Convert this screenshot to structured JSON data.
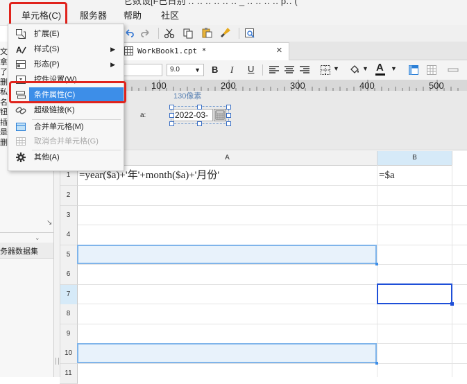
{
  "menubar": {
    "items": [
      "单元格(C)",
      "服务器",
      "帮助",
      "社区"
    ],
    "title_fragment": "它数设[F已日别 ‥  ‥   ‥ ‥  ‥ ‥ _  ‥ ‥ ‥ ‥ p‥ ("
  },
  "tab": {
    "label": "WorkBook1.cpt *",
    "close": "×"
  },
  "format_toolbar": {
    "font_size": "9.0",
    "bold": "B",
    "italic": "I",
    "underline": "U",
    "font_color": "A"
  },
  "ruler": {
    "ticks": [
      "100",
      "200",
      "300",
      "400",
      "500"
    ]
  },
  "param_area": {
    "px_label": "130像素",
    "param_label": "a:",
    "date_value": "2022-03-"
  },
  "left_panel": {
    "truncated_chars": [
      "文",
      "拿",
      "了",
      "删",
      "私",
      "名",
      "钮",
      "插",
      "是",
      "删"
    ],
    "dataset_label": "务器数据集"
  },
  "dropdown": {
    "items": [
      {
        "label": "扩展(E)",
        "icon": "expand-icon",
        "submenu": false,
        "disabled": false
      },
      {
        "label": "样式(S)",
        "icon": "style-icon",
        "submenu": true,
        "disabled": false
      },
      {
        "label": "形态(P)",
        "icon": "form-icon",
        "submenu": true,
        "disabled": false
      },
      {
        "label": "控件设置(W)",
        "icon": "widget-icon",
        "submenu": false,
        "disabled": false
      },
      {
        "label": "条件属性(C)",
        "icon": "condition-icon",
        "submenu": false,
        "disabled": false,
        "highlighted": true
      },
      {
        "label": "超级链接(K)",
        "icon": "link-icon",
        "submenu": false,
        "disabled": false
      },
      {
        "label": "合并单元格(M)",
        "icon": "merge-icon",
        "submenu": false,
        "disabled": false
      },
      {
        "label": "取消合并单元格(G)",
        "icon": "unmerge-icon",
        "submenu": false,
        "disabled": true
      },
      {
        "label": "其他(A)",
        "icon": "gear-icon",
        "submenu": false,
        "disabled": false
      }
    ]
  },
  "grid": {
    "columns": [
      "A",
      "B"
    ],
    "rows": [
      "1",
      "2",
      "3",
      "4",
      "5",
      "6",
      "7",
      "8",
      "9",
      "10",
      "11"
    ],
    "cells": {
      "A1": "=year($a)+'年'+month($a)+'月份'",
      "B1": "=$a"
    }
  },
  "colors": {
    "accent": "#3d8ee8",
    "highlight_red": "#e0231c",
    "selection_blue": "#1e4fd8"
  }
}
